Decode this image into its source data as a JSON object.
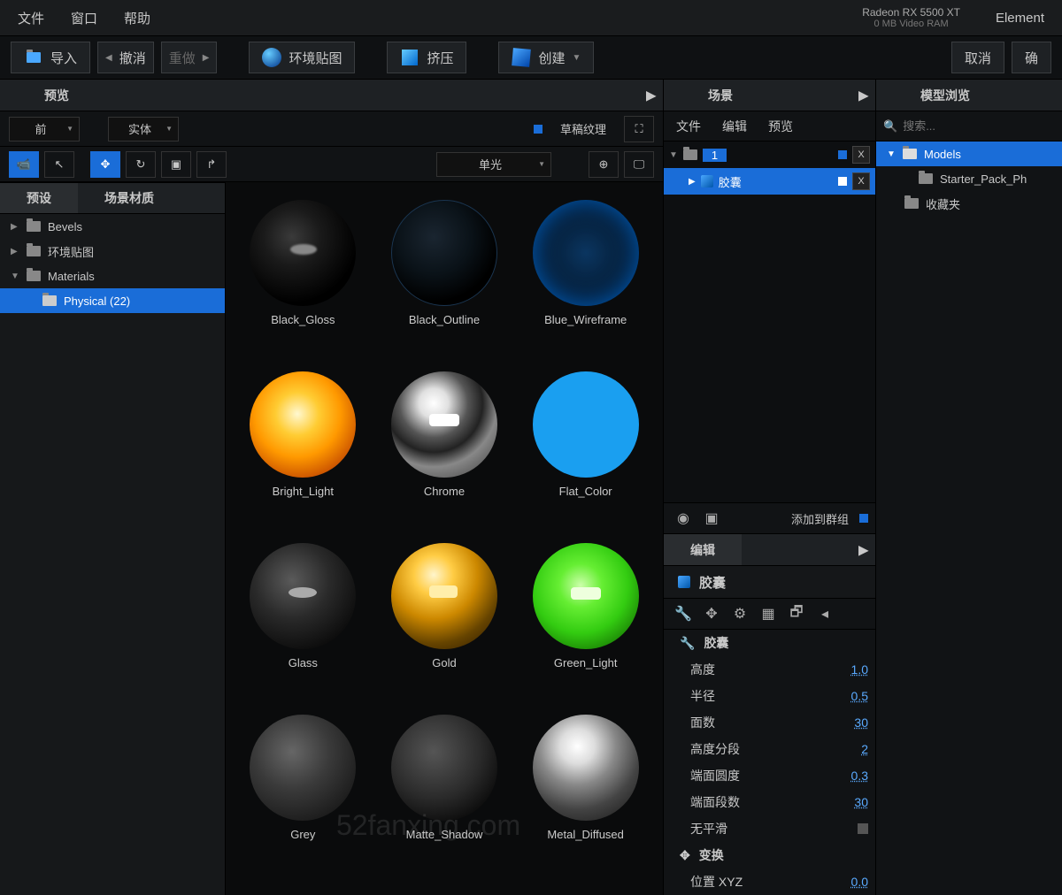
{
  "menubar": {
    "file": "文件",
    "window": "窗口",
    "help": "帮助"
  },
  "gpu": {
    "name": "Radeon RX 5500 XT",
    "ram": "0 MB Video RAM"
  },
  "element_label": "Element",
  "toolbar": {
    "import": "导入",
    "undo": "撤消",
    "redo": "重做",
    "envmap": "环境贴图",
    "extrude": "挤压",
    "create": "创建",
    "cancel": "取消",
    "ok": "确"
  },
  "preview": {
    "title": "预览",
    "view_sel": "前",
    "shade_sel": "实体",
    "draft_label": "草稿纹理",
    "light_sel": "单光"
  },
  "preset": {
    "tab_presets": "预设",
    "tab_scene_materials": "场景材质",
    "folders": {
      "bevels": "Bevels",
      "envmaps": "环境贴图",
      "materials": "Materials",
      "physical": "Physical (22)"
    }
  },
  "materials": [
    "Black_Gloss",
    "Black_Outline",
    "Blue_Wireframe",
    "Bright_Light",
    "Chrome",
    "Flat_Color",
    "Glass",
    "Gold",
    "Green_Light",
    "Grey",
    "Matte_Shadow",
    "Metal_Diffused"
  ],
  "scene": {
    "title": "场景",
    "menu": {
      "file": "文件",
      "edit": "编辑",
      "preview": "预览"
    },
    "group_number": "1",
    "item": "胶囊"
  },
  "editor": {
    "addgroup": "添加到群组",
    "tab": "编辑",
    "object": "胶囊",
    "section": "胶囊",
    "props": {
      "height": {
        "label": "高度",
        "value": "1.0"
      },
      "radius": {
        "label": "半径",
        "value": "0.5"
      },
      "sides": {
        "label": "面数",
        "value": "30"
      },
      "hseg": {
        "label": "高度分段",
        "value": "2"
      },
      "capround": {
        "label": "端面圆度",
        "value": "0.3"
      },
      "capseg": {
        "label": "端面段数",
        "value": "30"
      },
      "nosmooth": {
        "label": "无平滑"
      }
    },
    "transform_title": "变换",
    "position": {
      "label": "位置 XYZ",
      "value": "0.0"
    }
  },
  "modelbrowser": {
    "title": "模型浏览",
    "search_placeholder": "搜索...",
    "root": "Models",
    "starter": "Starter_Pack_Ph",
    "favorites": "收藏夹"
  },
  "watermark": "52fanxing.com"
}
